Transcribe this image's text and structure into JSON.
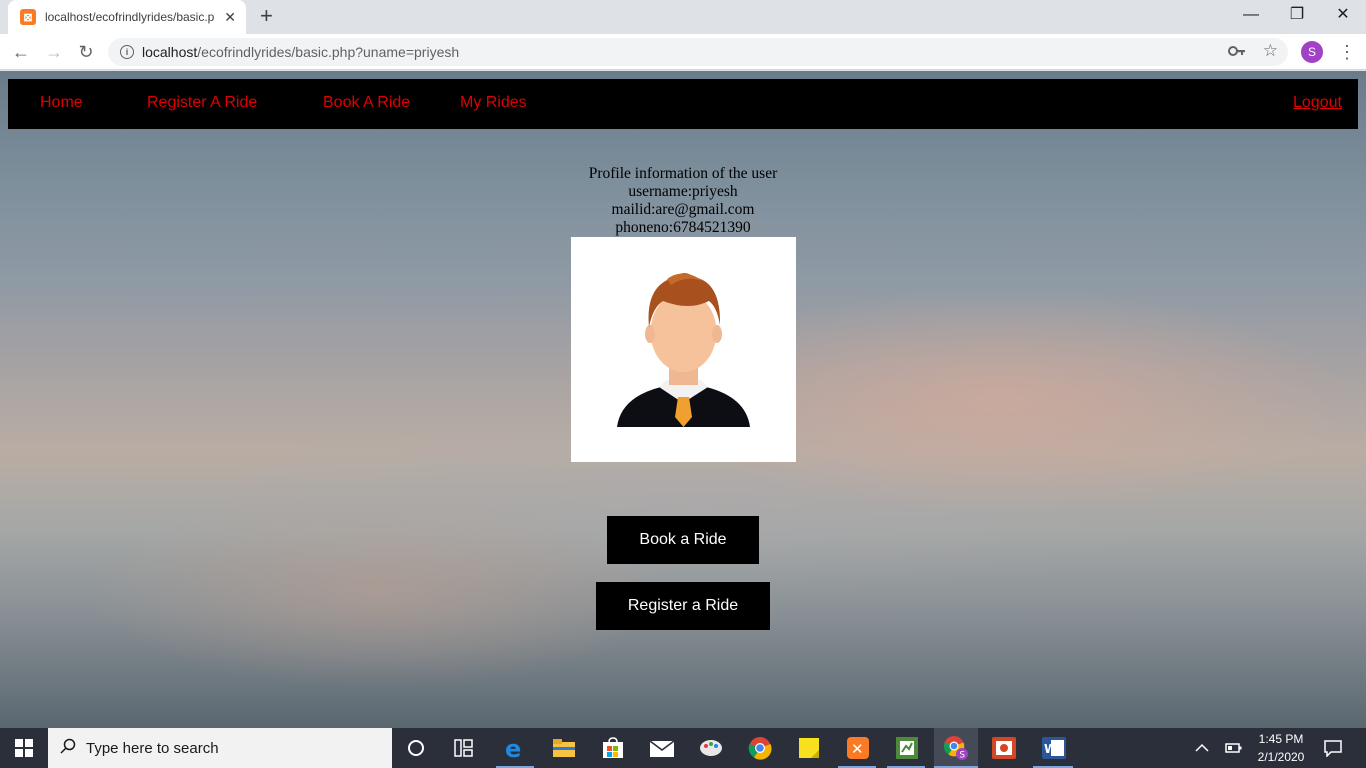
{
  "browser": {
    "tab_title": "localhost/ecofrindlyrides/basic.p",
    "tab_close": "✕",
    "new_tab": "+",
    "url_host": "localhost",
    "url_rest": "/ecofrindlyrides/basic.php?uname=priyesh",
    "avatar_letter": "S"
  },
  "navbar": {
    "home": "Home",
    "register_ride": "Register A Ride",
    "book_ride": "Book A Ride",
    "my_rides": "My Rides",
    "logout": "Logout"
  },
  "profile": {
    "heading": "Profile information of the user",
    "username": "username:priyesh",
    "mailid": "mailid:are@gmail.com",
    "phoneno": "phoneno:6784521390"
  },
  "actions": {
    "book": "Book a Ride",
    "register": "Register a Ride"
  },
  "taskbar": {
    "search_placeholder": "Type here to search",
    "time": "1:45 PM",
    "date": "2/1/2020"
  },
  "colors": {
    "nav_link": "#e00000",
    "nav_bg": "#000000",
    "avatar": "#a142c6",
    "xampp": "#fb7a24"
  }
}
